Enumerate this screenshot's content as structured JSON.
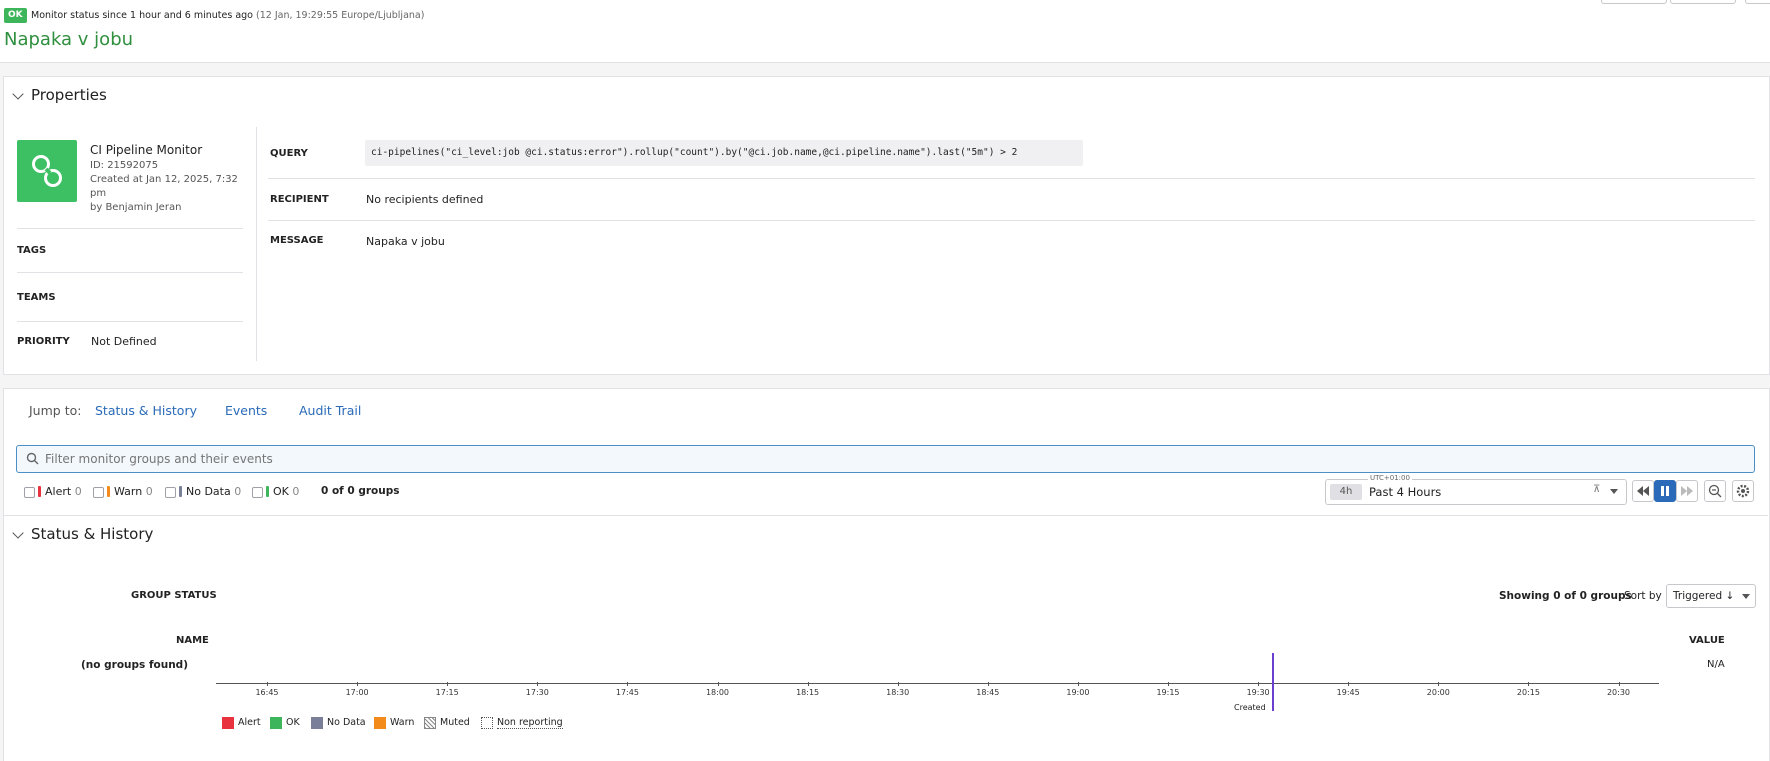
{
  "header": {
    "status_badge": "OK",
    "status_text": "Monitor status since 1 hour and 6 minutes ago",
    "status_time": "(12 Jan, 19:29:55 Europe/Ljubljana)",
    "title": "Napaka v jobu"
  },
  "properties": {
    "section_title": "Properties",
    "monitor_type": "CI Pipeline Monitor",
    "monitor_id": "ID: 21592075",
    "created_line1": "Created at Jan 12, 2025, 7:32",
    "created_line2": "pm",
    "created_by": "by Benjamin Jeran",
    "tags_label": "TAGS",
    "teams_label": "TEAMS",
    "priority_label": "PRIORITY",
    "priority_value": "Not Defined",
    "query_label": "QUERY",
    "query_value": "ci-pipelines(\"ci_level:job @ci.status:error\").rollup(\"count\").by(\"@ci.job.name,@ci.pipeline.name\").last(\"5m\") > 2",
    "recipient_label": "RECIPIENT",
    "recipient_value": "No recipients defined",
    "message_label": "MESSAGE",
    "message_value": "Napaka v jobu"
  },
  "jump": {
    "label": "Jump to:",
    "links": [
      "Status & History",
      "Events",
      "Audit Trail"
    ]
  },
  "search": {
    "placeholder": "Filter monitor groups and their events"
  },
  "filters": [
    {
      "label": "Alert",
      "count": "0",
      "color": "#e8333f"
    },
    {
      "label": "Warn",
      "count": "0",
      "color": "#f28b1a"
    },
    {
      "label": "No Data",
      "count": "0",
      "color": "#7a7f99"
    },
    {
      "label": "OK",
      "count": "0",
      "color": "#3db55a"
    }
  ],
  "groups_count": "0 of 0 groups",
  "timepicker": {
    "chip": "4h",
    "label": "Past 4 Hours",
    "tz": "UTC+01:00"
  },
  "status_history": {
    "section_title": "Status & History",
    "group_status_label": "GROUP STATUS",
    "showing": "Showing 0 of 0 groups",
    "sort_by_label": "Sort by",
    "sort_value": "Triggered ↓",
    "name_label": "NAME",
    "value_label": "VALUE",
    "no_groups": "(no groups found)",
    "value_na": "N/A",
    "created_marker": "Created",
    "ticks": [
      "16:45",
      "17:00",
      "17:15",
      "17:30",
      "17:45",
      "18:00",
      "18:15",
      "18:30",
      "18:45",
      "19:00",
      "19:15",
      "19:30",
      "19:45",
      "20:00",
      "20:15",
      "20:30"
    ]
  },
  "legend": [
    {
      "label": "Alert",
      "color": "#e8333f"
    },
    {
      "label": "OK",
      "color": "#3db55a"
    },
    {
      "label": "No Data",
      "color": "#7a7f99"
    },
    {
      "label": "Warn",
      "color": "#f28b1a"
    },
    {
      "label": "Muted",
      "color": "hatch"
    },
    {
      "label": "Non reporting",
      "color": "dotted"
    }
  ]
}
